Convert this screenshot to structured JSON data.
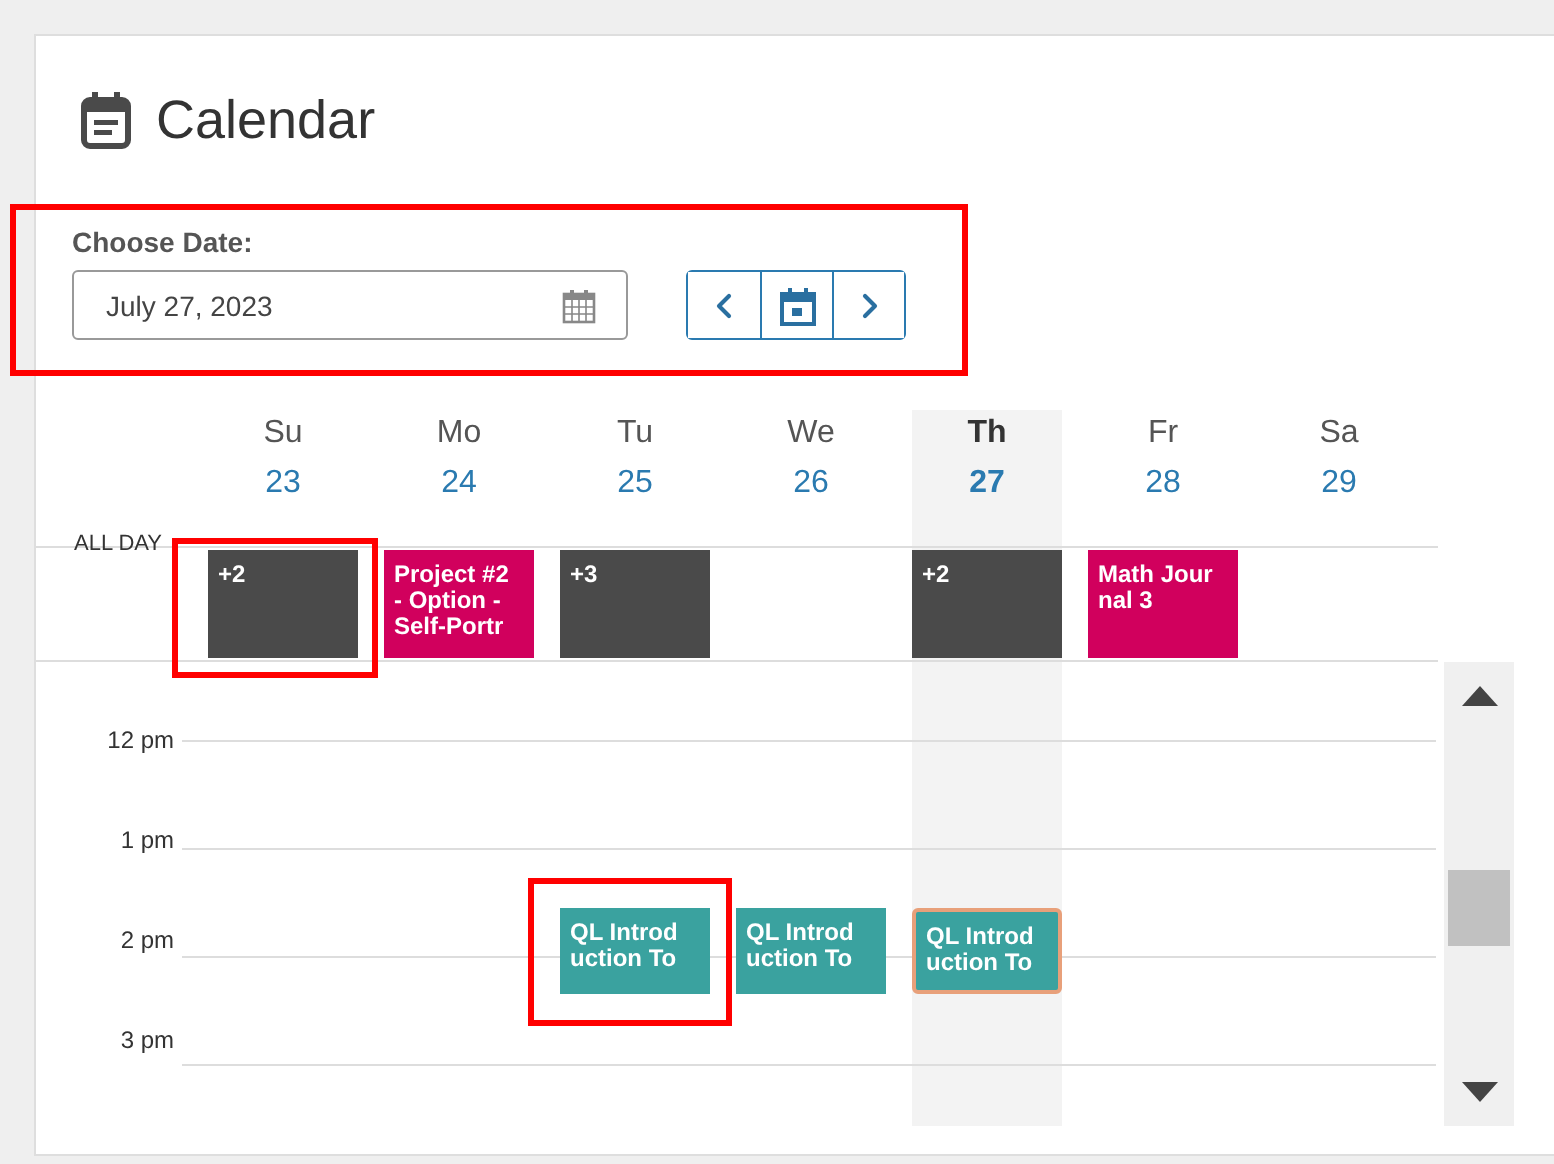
{
  "title": "Calendar",
  "date_picker": {
    "label": "Choose Date:",
    "value": "July 27, 2023",
    "highlighted": true
  },
  "all_day_label": "ALL DAY",
  "hours": [
    "12 pm",
    "1 pm",
    "2 pm",
    "3 pm"
  ],
  "days": [
    {
      "name": "Su",
      "date": "23",
      "today": false,
      "events": [
        {
          "kind": "all_day",
          "text": "+2",
          "color": "#4a4a4a",
          "selected": false,
          "highlighted": true
        }
      ]
    },
    {
      "name": "Mo",
      "date": "24",
      "today": false,
      "events": [
        {
          "kind": "all_day",
          "text": "Project #2\n- Option -\nSelf-Portr",
          "color": "#d1005d",
          "selected": false,
          "highlighted": false
        }
      ]
    },
    {
      "name": "Tu",
      "date": "25",
      "today": false,
      "events": [
        {
          "kind": "all_day",
          "text": "+3",
          "color": "#4a4a4a",
          "selected": false,
          "highlighted": false
        },
        {
          "kind": "timed",
          "text": "QL Introd\nuction To",
          "color": "#3aa29f",
          "selected": false,
          "highlighted": true
        }
      ]
    },
    {
      "name": "We",
      "date": "26",
      "today": false,
      "events": [
        {
          "kind": "timed",
          "text": "QL Introd\nuction To",
          "color": "#3aa29f",
          "selected": false,
          "highlighted": false
        }
      ]
    },
    {
      "name": "Th",
      "date": "27",
      "today": true,
      "events": [
        {
          "kind": "all_day",
          "text": "+2",
          "color": "#4a4a4a",
          "selected": false,
          "highlighted": false
        },
        {
          "kind": "timed",
          "text": "QL Introd\nuction To",
          "color": "#3aa29f",
          "selected": true,
          "highlighted": false
        }
      ]
    },
    {
      "name": "Fr",
      "date": "28",
      "today": false,
      "events": [
        {
          "kind": "all_day",
          "text": "Math Jour\nnal 3",
          "color": "#d1005d",
          "selected": false,
          "highlighted": false
        }
      ]
    },
    {
      "name": "Sa",
      "date": "29",
      "today": false
    }
  ]
}
